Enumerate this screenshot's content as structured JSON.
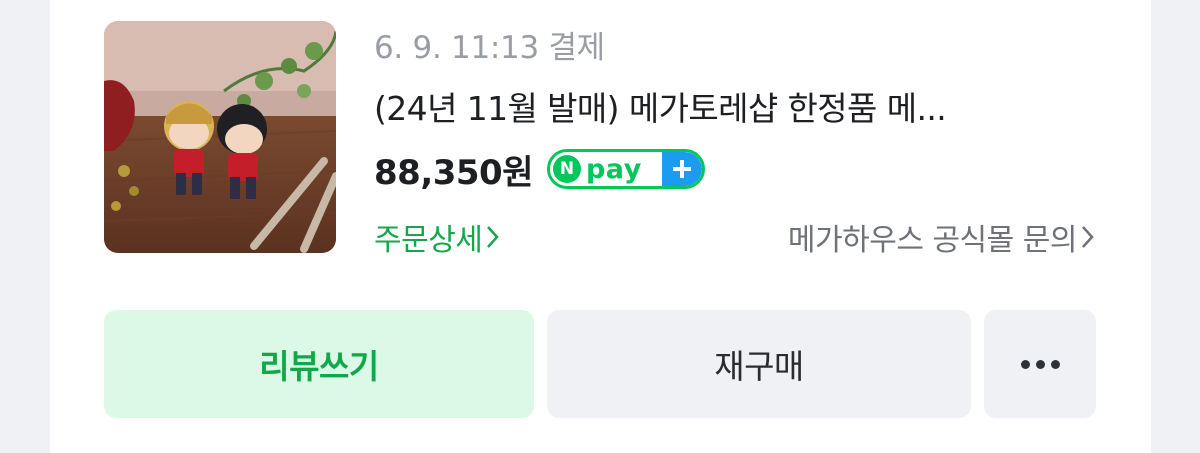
{
  "order": {
    "date_text": "6. 9. 11:13 결제",
    "product_title": "(24년 11월 발매) 메가토레샵 한정품 메...",
    "price": "88,350원",
    "npay_badge": {
      "n_letter": "N",
      "text": "pay",
      "plus": "+"
    },
    "detail_link": "주문상세",
    "inquiry_link": "메가하우스 공식몰 문의"
  },
  "actions": {
    "review_label": "리뷰쓰기",
    "rebuy_label": "재구매",
    "more_icon": "more-horizontal-icon"
  },
  "colors": {
    "background": "#eff1f4",
    "card": "#ffffff",
    "naver_green": "#03c75a",
    "npay_plus_blue": "#1b9cf0",
    "link_green": "#14a74c",
    "review_button_bg": "#dcf8e6",
    "secondary_button_bg": "#eff1f4"
  },
  "thumbnail": {
    "subject": "two chibi anime figurines on wooden table with plants"
  }
}
